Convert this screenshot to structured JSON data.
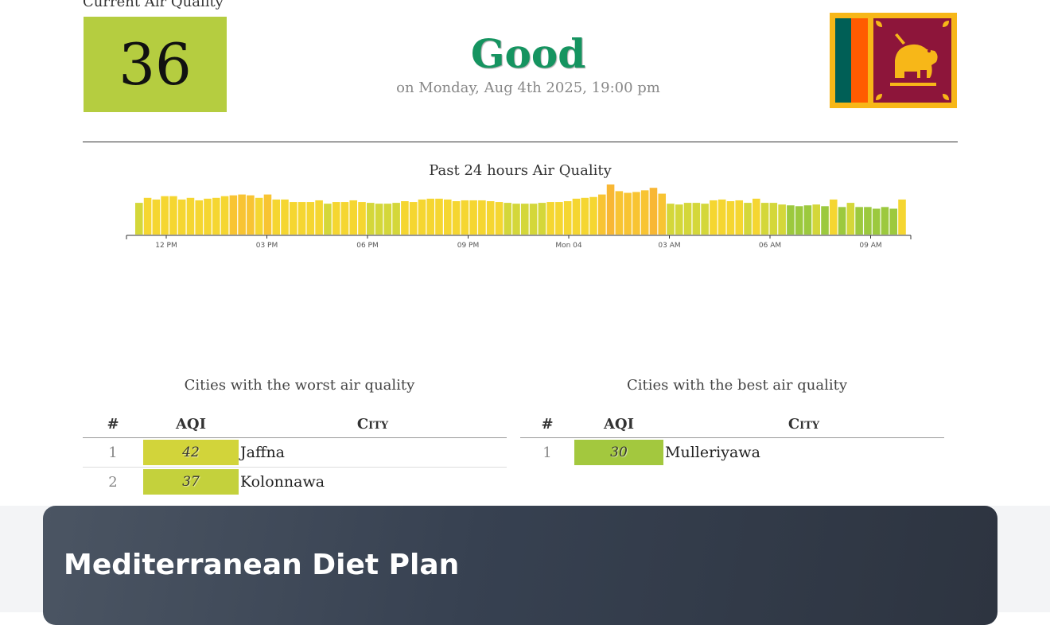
{
  "current": {
    "label": "Current Air Quality",
    "aqi": "36",
    "status": "Good",
    "updated": "on Monday, Aug 4th 2025, 19:00 pm",
    "flag_icon": "sri-lanka-flag"
  },
  "chart_data": {
    "type": "bar",
    "title": "Past 24 hours Air Quality",
    "xlabel": "",
    "ylabel": "",
    "x_tick_labels": [
      "12 PM",
      "03 PM",
      "06 PM",
      "09 PM",
      "Mon 04",
      "03 AM",
      "06 AM",
      "09 AM"
    ],
    "values": [
      38,
      44,
      42,
      46,
      46,
      42,
      44,
      41,
      43,
      44,
      46,
      47,
      48,
      47,
      44,
      48,
      42,
      42,
      39,
      39,
      39,
      41,
      37,
      39,
      39,
      41,
      39,
      38,
      37,
      37,
      38,
      40,
      39,
      42,
      43,
      43,
      42,
      40,
      41,
      41,
      41,
      40,
      39,
      38,
      37,
      37,
      37,
      38,
      39,
      39,
      40,
      43,
      44,
      45,
      48,
      60,
      52,
      50,
      51,
      53,
      56,
      49,
      37,
      36,
      38,
      38,
      37,
      41,
      42,
      40,
      41,
      38,
      43,
      38,
      38,
      36,
      35,
      34,
      35,
      36,
      34,
      42,
      33,
      38,
      33,
      33,
      31,
      33,
      31,
      42
    ],
    "series_colors": {
      "green": "#9cc93e",
      "yellow": "#f5d631",
      "orange": "#f8b734"
    }
  },
  "worst": {
    "title": "Cities with the worst air quality",
    "headers": {
      "rank": "#",
      "aqi": "AQI",
      "city": "City"
    },
    "rows": [
      {
        "rank": "1",
        "aqi": "42",
        "city": "Jaffna",
        "color": "#d2d43a"
      },
      {
        "rank": "2",
        "aqi": "37",
        "city": "Kolonnawa",
        "color": "#c4d13c"
      }
    ]
  },
  "best": {
    "title": "Cities with the best air quality",
    "headers": {
      "rank": "#",
      "aqi": "AQI",
      "city": "City"
    },
    "rows": [
      {
        "rank": "1",
        "aqi": "30",
        "city": "Mulleriyawa",
        "color": "#a3c83e"
      }
    ]
  },
  "banner": {
    "title": "Mediterranean Diet Plan"
  },
  "colors": {
    "good": "#159460",
    "aqi_box": "#b5cd40"
  }
}
